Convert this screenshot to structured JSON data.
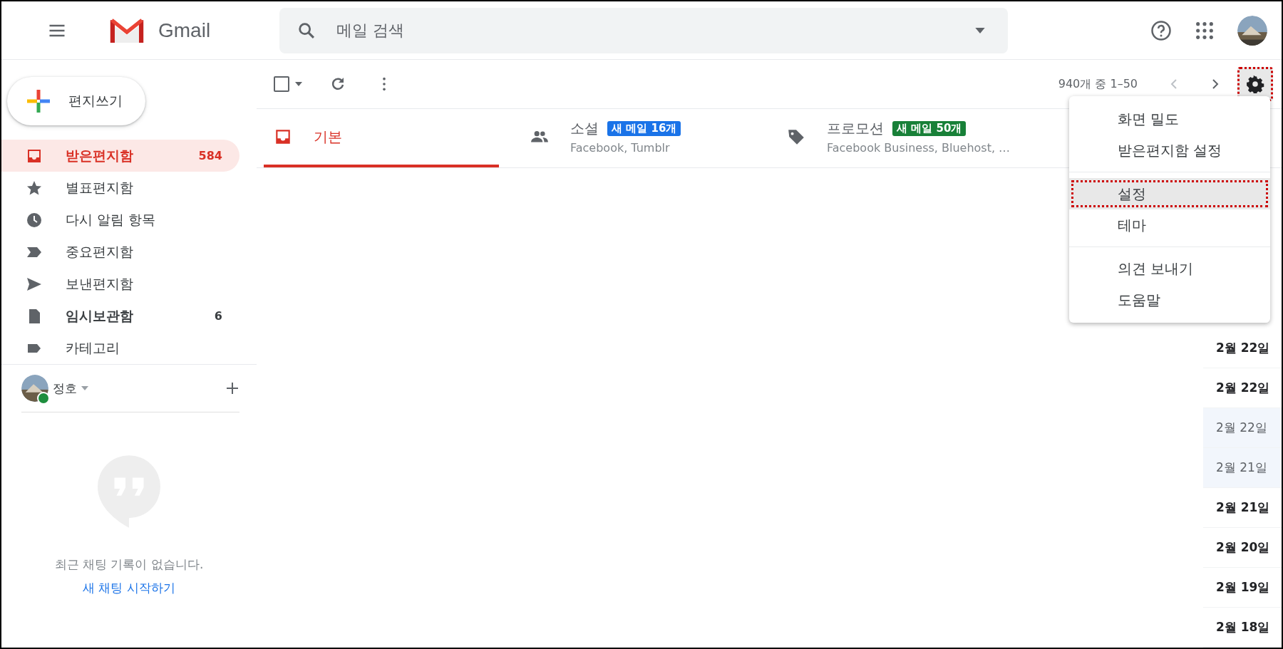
{
  "header": {
    "product": "Gmail",
    "search": {
      "placeholder": "메일 검색"
    }
  },
  "compose": {
    "label": "편지쓰기"
  },
  "nav": [
    {
      "kind": "inbox",
      "label": "받은편지함",
      "count": "584",
      "selected": true,
      "unread": true
    },
    {
      "kind": "star",
      "label": "별표편지함",
      "selected": false,
      "unread": false
    },
    {
      "kind": "clock",
      "label": "다시 알림 항목",
      "selected": false,
      "unread": false
    },
    {
      "kind": "important",
      "label": "중요편지함",
      "selected": false,
      "unread": false
    },
    {
      "kind": "send",
      "label": "보낸편지함",
      "selected": false,
      "unread": false
    },
    {
      "kind": "draft",
      "label": "임시보관함",
      "count": "6",
      "selected": false,
      "unread": true
    },
    {
      "kind": "label",
      "label": "카테고리",
      "selected": false,
      "unread": false
    }
  ],
  "chat": {
    "user": "정호",
    "online": true,
    "empty_message": "최근 채팅 기록이 없습니다.",
    "link": "새 채팅 시작하기"
  },
  "toolbar": {
    "select_all": false,
    "range": "940개 중 1–50"
  },
  "tabs": [
    {
      "kind": "primary",
      "label": "기본",
      "selected": true
    },
    {
      "kind": "social",
      "label": "소셜",
      "badge": "새 메일 16개",
      "senders": "Facebook, Tumblr",
      "selected": false
    },
    {
      "kind": "promotions",
      "label": "프로모션",
      "badge": "새 메일 50개",
      "senders": "Facebook Business, Bluehost, …",
      "selected": false
    }
  ],
  "messages": [
    {
      "date": "2월 22일",
      "read": false
    },
    {
      "date": "2월 22일",
      "read": false
    },
    {
      "date": "2월 22일",
      "read": true
    },
    {
      "date": "2월 21일",
      "read": true
    },
    {
      "date": "2월 21일",
      "read": false
    },
    {
      "date": "2월 20일",
      "read": false
    },
    {
      "date": "2월 19일",
      "read": false
    },
    {
      "date": "2월 18일",
      "read": false
    }
  ],
  "settings_menu": {
    "open": true,
    "groups": [
      [
        {
          "label": "화면 밀도",
          "selected": false
        },
        {
          "label": "받은편지함 설정",
          "selected": false
        }
      ],
      [
        {
          "label": "설정",
          "selected": true
        },
        {
          "label": "테마",
          "selected": false
        }
      ],
      [
        {
          "label": "의견 보내기",
          "selected": false
        },
        {
          "label": "도움말",
          "selected": false
        }
      ]
    ]
  }
}
